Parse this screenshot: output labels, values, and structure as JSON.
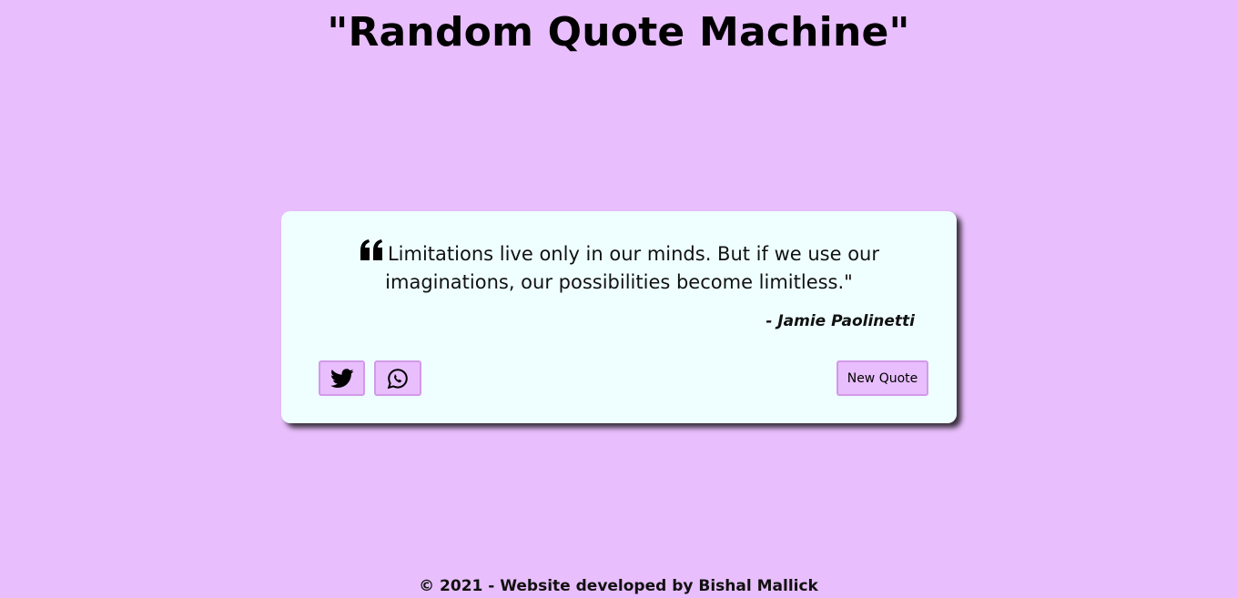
{
  "header": {
    "title": "\"Random Quote Machine\""
  },
  "quote_card": {
    "quote_icon": "quote-left-icon",
    "quote_text": "Limitations live only in our minds. But if we use our imaginations, our possibilities become limitless.\"",
    "author": "- Jamie Paolinetti",
    "share_buttons": [
      {
        "name": "twitter",
        "icon": "twitter-icon"
      },
      {
        "name": "whatsapp",
        "icon": "whatsapp-icon"
      }
    ],
    "new_quote_label": "New Quote"
  },
  "footer": {
    "text": "© 2021 - Website developed by Bishal Mallick"
  },
  "colors": {
    "background": "#e8befc",
    "card": "#efffff",
    "button_border": "#d29ae8"
  }
}
